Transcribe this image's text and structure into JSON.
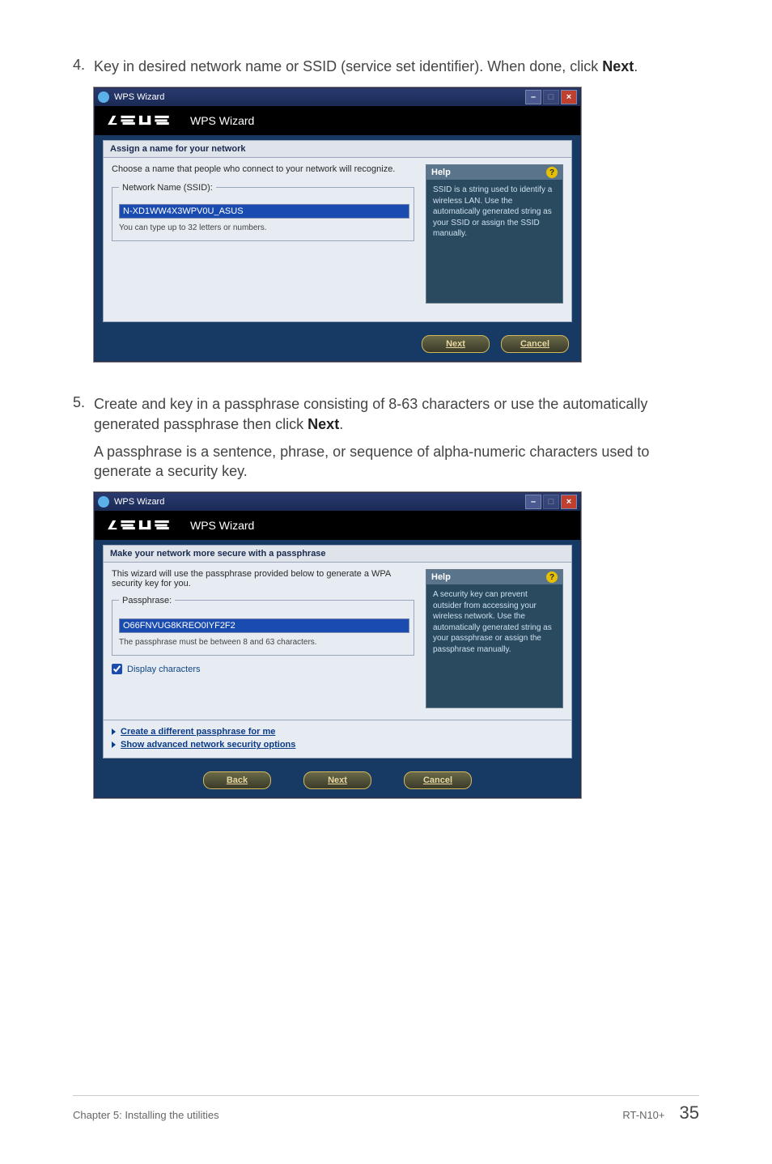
{
  "step4": {
    "num": "4.",
    "text_pre": "Key in desired network name or SSID (service set identifier). When done, click ",
    "bold": "Next",
    "text_post": "."
  },
  "step5": {
    "num": "5.",
    "text_pre": "Create and key in a passphrase consisting of 8-63 characters or use the automatically generated passphrase then click ",
    "bold": "Next",
    "text_post": "."
  },
  "step5_sub": "A passphrase is a sentence, phrase, or sequence of alpha-numeric characters used to generate a security key.",
  "wiz_title": "WPS Wizard",
  "brand_title": "WPS Wizard",
  "wiz1": {
    "section_head": "Assign a name for your network",
    "intro": "Choose a name that people who connect to your network will recognize.",
    "legend": "Network Name (SSID):",
    "ssid_value": "N-XD1WW4X3WPV0U_ASUS",
    "hint": "You can type up to 32 letters or numbers.",
    "help_head": "Help",
    "help_body": "SSID is a string used to identify a wireless LAN. Use the automatically generated string as your SSID or assign the SSID manually.",
    "btn_next": "Next",
    "btn_cancel": "Cancel"
  },
  "wiz2": {
    "section_head": "Make your network more secure with a passphrase",
    "intro": "This wizard will use the passphrase provided below to generate a WPA security key for you.",
    "legend": "Passphrase:",
    "pass_value": "O66FNVUG8KREO0IYF2F2",
    "hint": "The passphrase must be between 8 and 63 characters.",
    "chk_label": "Display characters",
    "link1": "Create a different passphrase for me",
    "link2": "Show advanced network security options",
    "help_head": "Help",
    "help_body": "A security key can prevent outsider from accessing your wireless network. Use the automatically generated string as your passphrase or assign the passphrase manually.",
    "btn_back": "Back",
    "btn_next": "Next",
    "btn_cancel": "Cancel"
  },
  "footer": {
    "left": "Chapter 5: Installing the utilities",
    "model": "RT-N10+",
    "page": "35"
  }
}
